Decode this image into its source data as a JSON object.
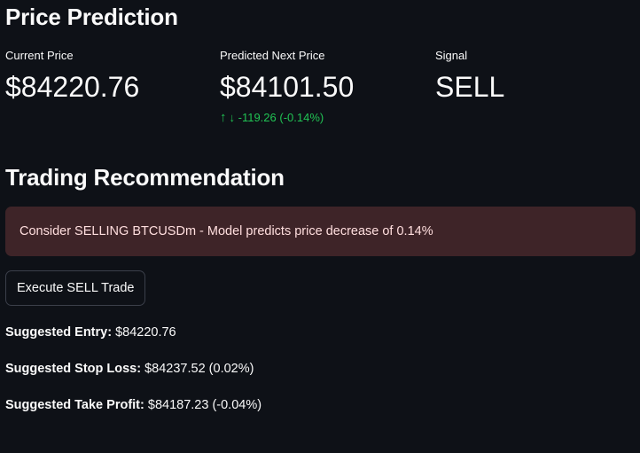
{
  "prediction": {
    "title": "Price Prediction",
    "current_price_label": "Current Price",
    "current_price_value": "$84220.76",
    "predicted_label": "Predicted Next Price",
    "predicted_value": "$84101.50",
    "predicted_delta": "-119.26 (-0.14%)",
    "delta_arrow": "↓",
    "delta_up_icon": "↑",
    "signal_label": "Signal",
    "signal_value": "SELL",
    "colors": {
      "delta": "#21c354",
      "alert_bg": "#3e2428",
      "alert_text": "#ffdede",
      "background": "#0e1117"
    }
  },
  "recommendation": {
    "title": "Trading Recommendation",
    "alert_text": "Consider SELLING BTCUSDm - Model predicts price decrease of 0.14%",
    "execute_button": "Execute SELL Trade",
    "entry_label": "Suggested Entry:",
    "entry_value": "$84220.76",
    "stop_loss_label": "Suggested Stop Loss:",
    "stop_loss_value": "$84237.52 (0.02%)",
    "take_profit_label": "Suggested Take Profit:",
    "take_profit_value": "$84187.23 (-0.04%)"
  }
}
